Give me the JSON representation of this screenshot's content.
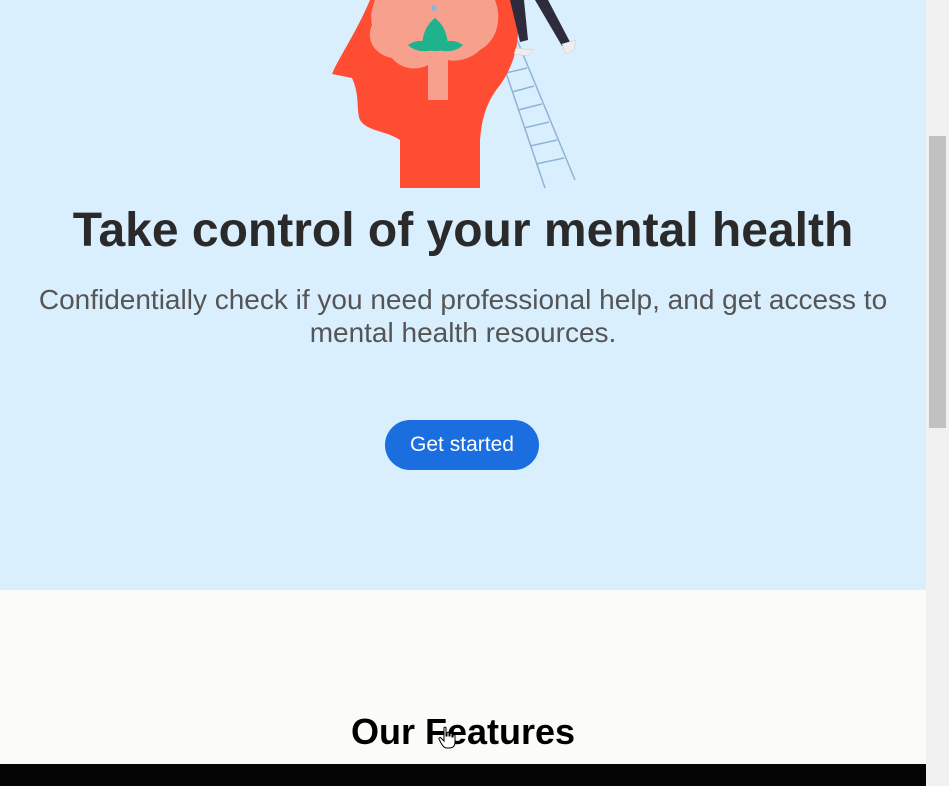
{
  "hero": {
    "title": "Take control of your mental health",
    "subtitle": "Confidentially check if you need professional help, and get access to mental health resources.",
    "cta_label": "Get started",
    "illustration_icon": "mental-health-head-icon"
  },
  "features": {
    "title": "Our Features"
  },
  "colors": {
    "hero_bg": "#daeffe",
    "page_bg": "#fbfcf7",
    "accent": "#1a6ee0",
    "head": "#ff4d33",
    "brain": "#f7a08d",
    "lotus": "#1fb38d"
  }
}
